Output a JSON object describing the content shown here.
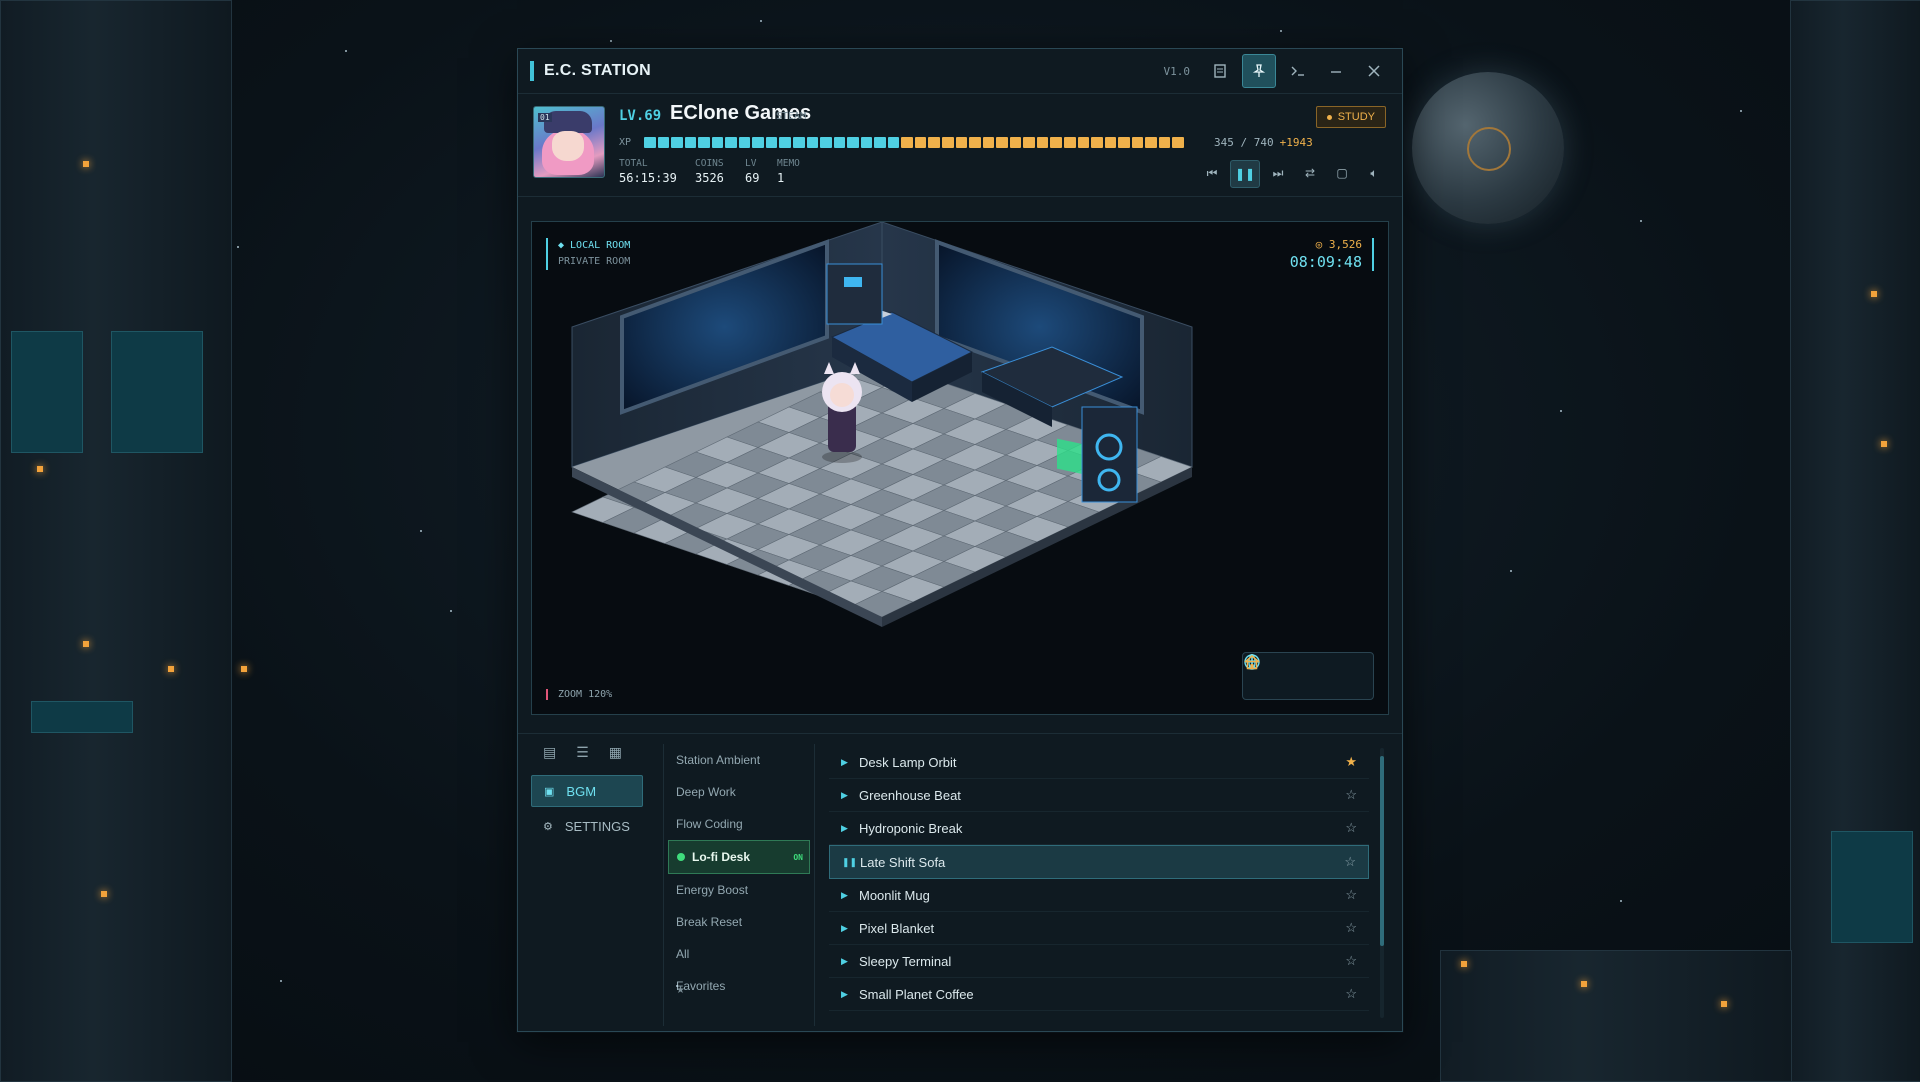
{
  "window": {
    "title": "E.C. STATION",
    "version": "V1.0"
  },
  "titlebar_icons": [
    "note-icon",
    "pin-icon",
    "terminal-icon",
    "minimize-icon",
    "close-icon"
  ],
  "profile": {
    "avatar_badge": "01",
    "level": "LV.69",
    "name": "EClone Games",
    "platform": "STEAM",
    "mode": "STUDY",
    "xp_label": "XP",
    "xp_text": "345 / 740",
    "xp_gain": "+1943",
    "xp_progress": 0.466,
    "stats": [
      {
        "key": "TOTAL",
        "value": "56:15:39"
      },
      {
        "key": "COINS",
        "value": "3526"
      },
      {
        "key": "LV",
        "value": "69"
      },
      {
        "key": "MEMO",
        "value": "1"
      }
    ]
  },
  "player_controls": [
    "previous-icon",
    "pause-icon",
    "next-icon",
    "shuffle-icon",
    "repeat-icon",
    "volume-icon"
  ],
  "room": {
    "location": "◆ LOCAL ROOM",
    "sublocation": "PRIVATE ROOM",
    "coins": "◎ 3,526",
    "clock": "08:09:48",
    "zoom": "ZOOM 120%",
    "tools": [
      "globe-icon",
      "character-icon",
      "home-icon"
    ]
  },
  "sidebar": {
    "icons": [
      "document-icon",
      "list-icon",
      "grid-icon"
    ],
    "items": [
      {
        "label": "BGM",
        "icon": "music-icon",
        "active": true
      },
      {
        "label": "SETTINGS",
        "icon": "gear-icon",
        "active": false
      }
    ]
  },
  "categories": [
    {
      "label": "Station Ambient"
    },
    {
      "label": "Deep Work"
    },
    {
      "label": "Flow Coding"
    },
    {
      "label": "Lo-fi Desk",
      "active": true,
      "badge": "ON"
    },
    {
      "label": "Energy Boost"
    },
    {
      "label": "Break Reset"
    },
    {
      "label": "All"
    },
    {
      "label": "Favorites",
      "icon": "star-icon"
    }
  ],
  "tracks": [
    {
      "title": "Desk Lamp Orbit",
      "favorite": true
    },
    {
      "title": "Greenhouse Beat",
      "favorite": false
    },
    {
      "title": "Hydroponic Break",
      "favorite": false
    },
    {
      "title": "Late Shift Sofa",
      "favorite": false,
      "playing": true
    },
    {
      "title": "Moonlit Mug",
      "favorite": false
    },
    {
      "title": "Pixel Blanket",
      "favorite": false
    },
    {
      "title": "Sleepy Terminal",
      "favorite": false
    },
    {
      "title": "Small Planet Coffee",
      "favorite": false
    }
  ],
  "colors": {
    "accent": "#4fd0e3",
    "gold": "#f0b14b",
    "green": "#3fdc7c",
    "panel": "#0f1a21"
  }
}
